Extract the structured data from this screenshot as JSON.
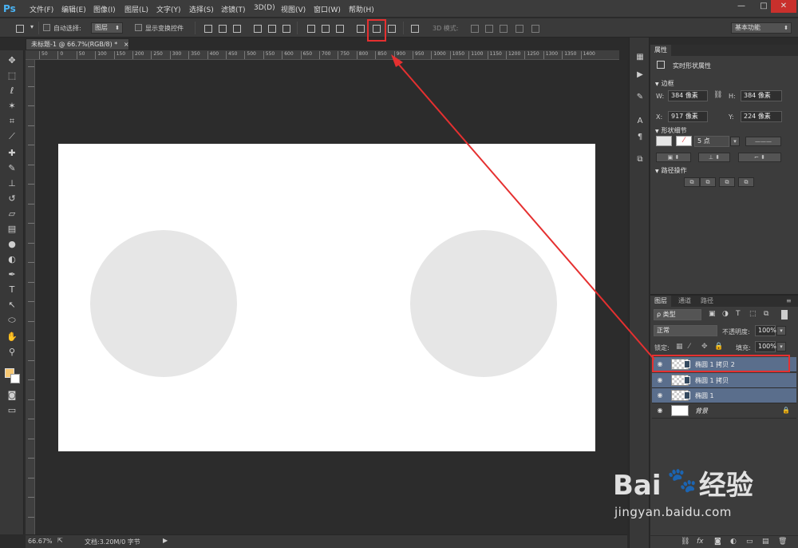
{
  "app": {
    "logo": "Ps"
  },
  "menu": [
    "文件(F)",
    "编辑(E)",
    "图像(I)",
    "图层(L)",
    "文字(Y)",
    "选择(S)",
    "滤镜(T)",
    "3D(D)",
    "视图(V)",
    "窗口(W)",
    "帮助(H)"
  ],
  "window_buttons": {
    "minimize": "—",
    "restore": "□",
    "close": "✕"
  },
  "options": {
    "auto_select_label": "自动选择:",
    "auto_select_value": "图层",
    "show_transform_label": "显示变换控件",
    "mode_3d_label": "3D 模式:",
    "workspace": "基本功能"
  },
  "document": {
    "tab_title": "未标题-1 @ 66.7%(RGB/8) *",
    "tab_close": "×",
    "ruler_top": [
      "50",
      "0",
      "50",
      "100",
      "150",
      "200",
      "250",
      "300",
      "350",
      "400",
      "450",
      "500",
      "550",
      "600",
      "650",
      "700",
      "750",
      "800",
      "850",
      "900",
      "950",
      "1000",
      "1050",
      "1100",
      "1150",
      "1200",
      "1250",
      "1300",
      "1350",
      "1400"
    ],
    "zoom": "66.67%",
    "doc_info": "文档:3.20M/0 字节"
  },
  "properties": {
    "tab": "属性",
    "header": "实时形状属性",
    "section_bounds": "边框",
    "w_label": "W:",
    "w_value": "384 像素",
    "h_label": "H:",
    "h_value": "384 像素",
    "x_label": "X:",
    "x_value": "917 像素",
    "y_label": "Y:",
    "y_value": "224 像素",
    "section_shape": "形状细节",
    "stroke_size": "5 点",
    "section_path": "路径操作"
  },
  "layers": {
    "tabs": [
      "图层",
      "通道",
      "路径"
    ],
    "filter_type": "ρ 类型",
    "blend_mode": "正常",
    "opacity_label": "不透明度:",
    "opacity_value": "100%",
    "lock_label": "锁定:",
    "fill_label": "填充:",
    "fill_value": "100%",
    "items": [
      {
        "name": "椭圆 1 拷贝 2",
        "selected": true
      },
      {
        "name": "椭圆 1 拷贝",
        "selected": true
      },
      {
        "name": "椭圆 1",
        "selected": true
      },
      {
        "name": "背景",
        "selected": false
      }
    ]
  },
  "watermark": {
    "brand": "Bai    经验",
    "url": "jingyan.baidu.com"
  }
}
